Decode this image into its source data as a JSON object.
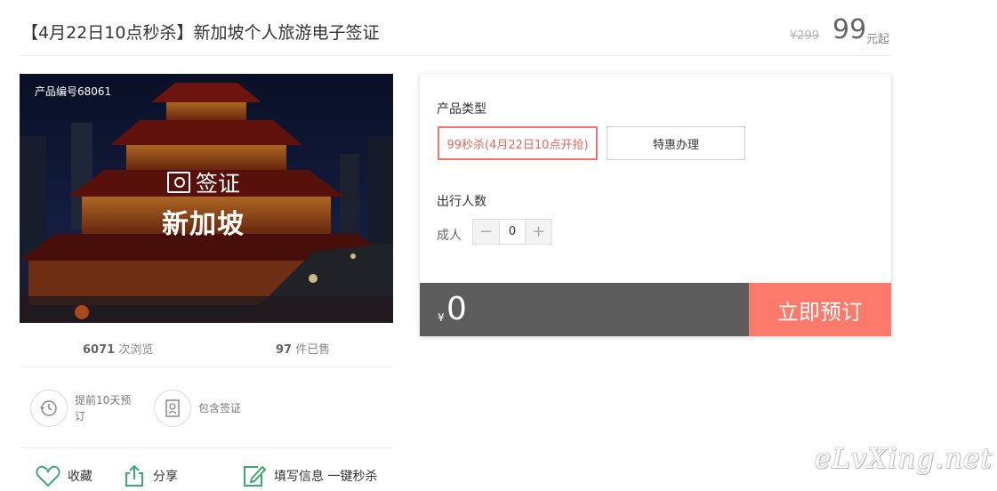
{
  "header": {
    "title": "【4月22日10点秒杀】新加坡个人旅游电子签证",
    "price_old": "¥299",
    "price": "99",
    "price_suffix": "元起"
  },
  "hero": {
    "product_code": "产品编号68061",
    "visa_label": "签证",
    "destination": "新加坡"
  },
  "stats": {
    "views_count": "6071",
    "views_label": "次浏览",
    "sold_count": "97",
    "sold_label": "件已售"
  },
  "features": [
    {
      "icon": "clock-icon",
      "label": "提前10天预订"
    },
    {
      "icon": "id-card-icon",
      "label": "包含签证"
    }
  ],
  "actions": [
    {
      "icon": "heart-icon",
      "label": "收藏"
    },
    {
      "icon": "share-icon",
      "label": "分享"
    },
    {
      "icon": "edit-icon",
      "label": "填写信息 一键秒杀"
    }
  ],
  "booking": {
    "type_title": "产品类型",
    "types": [
      {
        "label": "99秒杀(4月22日10点开抢)",
        "selected": true
      },
      {
        "label": "特惠办理",
        "selected": false
      }
    ],
    "people_title": "出行人数",
    "adult_label": "成人",
    "adult_count": "0",
    "minus": "−",
    "plus": "+",
    "currency": "¥",
    "total": "0",
    "book_label": "立即预订"
  },
  "watermark": "eLvXing.net",
  "colors": {
    "accent": "#fb7a6c",
    "selected_border": "#f1756a",
    "total_bar": "#5d5d5d"
  }
}
